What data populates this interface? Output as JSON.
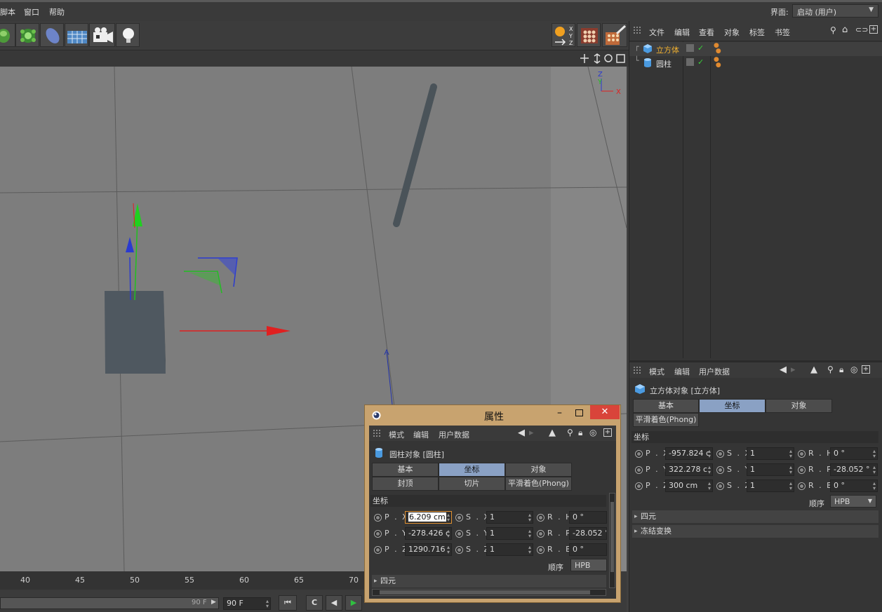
{
  "menubar": {
    "items": [
      "脚本",
      "窗口",
      "帮助"
    ],
    "layout_label": "界面:",
    "layout_value": "启动 (用户)"
  },
  "toolbar": {
    "tools": [
      "cube-tool-icon",
      "mograph-icon",
      "deformer-icon",
      "floor-icon",
      "camera-icon",
      "light-icon"
    ],
    "right_tools": [
      "coordinate-system-icon",
      "render-view-icon",
      "render-settings-icon"
    ]
  },
  "viewport": {
    "axis_labels": [
      "Z",
      "Y",
      "X"
    ]
  },
  "timeline": {
    "ticks": [
      "40",
      "45",
      "50",
      "55",
      "60",
      "65",
      "70"
    ],
    "end_field": "90 F",
    "frame_field": "90 F"
  },
  "object_manager": {
    "menu": [
      "文件",
      "编辑",
      "查看",
      "对象",
      "标签",
      "书签"
    ],
    "objects": [
      {
        "name": "立方体",
        "selected": true
      },
      {
        "name": "圆柱",
        "selected": false
      }
    ]
  },
  "attributes": {
    "menu": [
      "模式",
      "编辑",
      "用户数据"
    ],
    "object_title": "立方体对象 [立方体]",
    "tabs": [
      "基本",
      "坐标",
      "对象",
      "平滑着色(Phong)"
    ],
    "active_tab": "坐标",
    "section": "坐标",
    "rows": [
      {
        "p_label": "P . X",
        "p": "-957.824 c",
        "s_label": "S . X",
        "s": "1",
        "r_label": "R . H",
        "r": "0 °"
      },
      {
        "p_label": "P . Y",
        "p": "322.278 c",
        "s_label": "S . Y",
        "s": "1",
        "r_label": "R . P",
        "r": "-28.052 °"
      },
      {
        "p_label": "P . Z",
        "p": "300 cm",
        "s_label": "S . Z",
        "s": "1",
        "r_label": "R . B",
        "r": "0 °"
      }
    ],
    "order_label": "顺序",
    "order_value": "HPB",
    "folds": [
      "四元",
      "冻结变换"
    ]
  },
  "dialog": {
    "title": "属性",
    "menu": [
      "模式",
      "编辑",
      "用户数据"
    ],
    "object_title": "圆柱对象 [圆柱]",
    "tabs_row1": [
      "基本",
      "坐标",
      "对象"
    ],
    "tabs_row2": [
      "封顶",
      "切片",
      "平滑着色(Phong)"
    ],
    "active_tab": "坐标",
    "section": "坐标",
    "rows": [
      {
        "p_label": "P . X",
        "p": "6.209 cm",
        "s_label": "S . X",
        "s": "1",
        "r_label": "R . H",
        "r": "0 °"
      },
      {
        "p_label": "P . Y",
        "p": "-278.426 c",
        "s_label": "S . Y",
        "s": "1",
        "r_label": "R . P",
        "r": "-28.052 °"
      },
      {
        "p_label": "P . Z",
        "p": "1290.716",
        "s_label": "S . Z",
        "s": "1",
        "r_label": "R . B",
        "r": "0 °"
      }
    ],
    "order_label": "顺序",
    "order_value": "HPB",
    "fold": "四元"
  },
  "colors": {
    "accent_tab": "#8aa1c4",
    "selected_object": "#f0b030",
    "dialog_frame": "#c8a36f",
    "close_button": "#d9443a"
  }
}
